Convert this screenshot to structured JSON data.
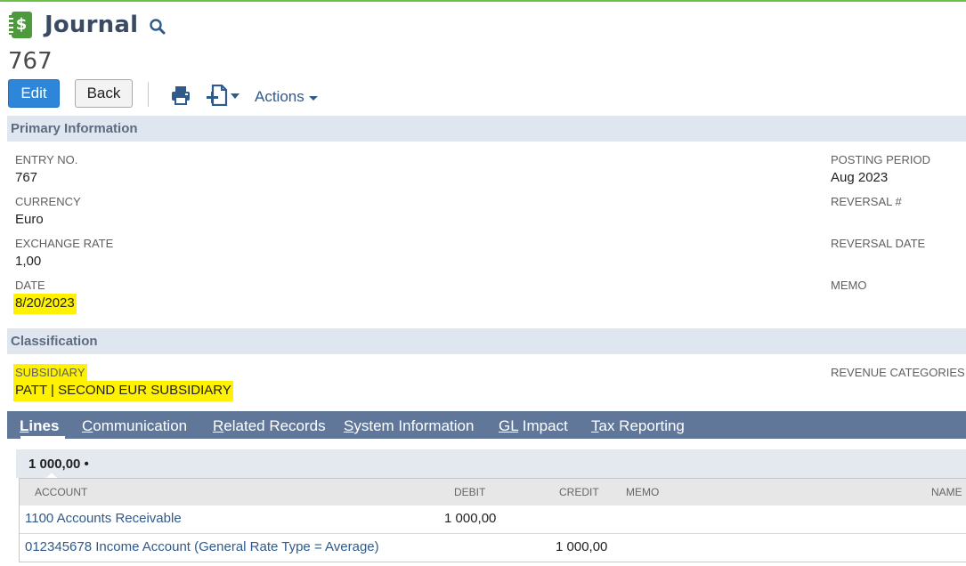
{
  "header": {
    "page_kind": "Journal",
    "record_number": "767"
  },
  "toolbar": {
    "edit_label": "Edit",
    "back_label": "Back",
    "actions_label": "Actions"
  },
  "icons": {
    "page_icon": "journal-icon",
    "search": "search-icon",
    "print": "print-icon",
    "new_document": "new-document-icon",
    "dropdown": "chevron-down-icon"
  },
  "colors": {
    "primary_button": "#2d86d9",
    "tab_bar": "#607799",
    "section_bar": "#e0e6ef",
    "highlight": "#fff200",
    "link": "#2e5a8c"
  },
  "primary_information": {
    "title": "Primary Information",
    "fields": {
      "entry_no": {
        "label": "ENTRY NO.",
        "value": "767"
      },
      "currency": {
        "label": "CURRENCY",
        "value": "Euro"
      },
      "exchange_rate": {
        "label": "EXCHANGE RATE",
        "value": "1,00"
      },
      "date": {
        "label": "DATE",
        "value": "8/20/2023"
      },
      "posting_period": {
        "label": "POSTING PERIOD",
        "value": "Aug 2023"
      },
      "reversal_no": {
        "label": "REVERSAL #",
        "value": ""
      },
      "reversal_date": {
        "label": "REVERSAL DATE",
        "value": ""
      },
      "memo": {
        "label": "MEMO",
        "value": ""
      }
    }
  },
  "classification": {
    "title": "Classification",
    "fields": {
      "subsidiary": {
        "label": "SUBSIDIARY",
        "value": "PATT | SECOND EUR SUBSIDIARY"
      },
      "revenue_categories": {
        "label": "REVENUE CATEGORIES",
        "value": ""
      }
    }
  },
  "tabs": [
    {
      "first": "L",
      "rest": "ines",
      "active": true
    },
    {
      "first": "C",
      "rest": "ommunication",
      "active": false
    },
    {
      "first": "R",
      "rest": "elated Records",
      "active": false
    },
    {
      "first": "S",
      "rest": "ystem Information",
      "active": false
    },
    {
      "first": "GL",
      "rest": " Impact",
      "active": false
    },
    {
      "first": "T",
      "rest": "ax Reporting",
      "active": false
    }
  ],
  "lines": {
    "subtab_label": "1 000,00 •",
    "columns": [
      "ACCOUNT",
      "DEBIT",
      "CREDIT",
      "MEMO",
      "NAME"
    ],
    "rows": [
      {
        "account": "1100 Accounts Receivable",
        "debit": "1 000,00",
        "credit": "",
        "memo": "",
        "name": ""
      },
      {
        "account": "012345678 Income Account (General Rate Type = Average)",
        "debit": "",
        "credit": "1 000,00",
        "memo": "",
        "name": ""
      }
    ]
  }
}
